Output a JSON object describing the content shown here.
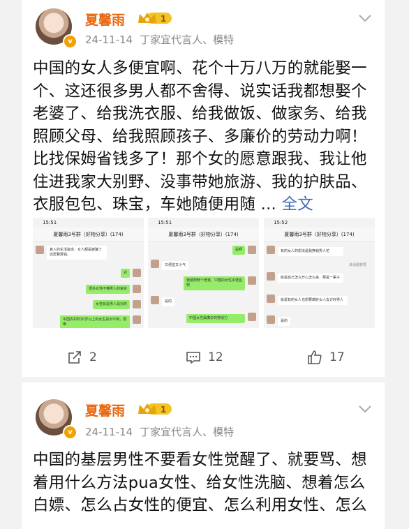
{
  "posts": [
    {
      "username": "夏馨雨",
      "level": "1",
      "verify_badge": "v",
      "date": "24-11-14",
      "source": "丁家宜代言人、模特",
      "text": "中国的女人多便宜啊、花个十万八万的就能娶一个、这还很多男人都不舍得、说实话我都想娶个老婆了、给我洗衣服、给我做饭、做家务、给我照顾父母、给我照顾孩子、多廉价的劳动力啊！比找保姆省钱多了！那个女的愿意跟我、我让他住进我家大别野、没事带她旅游、我的护肤品、衣服包包、珠宝，车她随便用随 ...",
      "more_label": "全文",
      "screenshots": [
        {
          "time": "15:51",
          "title": "夏馨雨3号群（好物分享）(174)",
          "messages": [
            {
              "side": "left",
              "text": "真人的生活姿态、女人都是被骗了还帮着数钱。"
            },
            {
              "side": "right",
              "text": "对"
            },
            {
              "side": "left",
              "text": "很多女性不懂男人的卑劣"
            },
            {
              "side": "right",
              "text": "女性就是男人是对的"
            },
            {
              "side": "right",
              "text": "中国农村的30岁以上的女生找对不到、很难"
            }
          ]
        },
        {
          "time": "15:51",
          "title": "夏馨雨3号群（好物分享）(174)",
          "messages": [
            {
              "side": "right",
              "text": "是啊"
            },
            {
              "side": "left",
              "text": "又便宜又小气"
            },
            {
              "side": "right",
              "text": "我都想娶个老婆、中国的女性多便宜啊"
            },
            {
              "side": "left",
              "text": "是的"
            },
            {
              "side": "right",
              "text": "中国女性最廉价的劳动力"
            }
          ]
        },
        {
          "time": "15:52",
          "title": "夏馨雨3号群（好物分享）(174)",
          "messages": [
            {
              "side": "left",
              "text": "有的女人的想法是我挣钱男人花"
            },
            {
              "side": "right",
              "text": "该话题获赞"
            },
            {
              "side": "left",
              "text": "就是自己怎么开心怎么来、那是一辈子"
            },
            {
              "side": "left",
              "text": "就是有的女人也想要做好女人去讨好男人"
            },
            {
              "side": "right",
              "text": "是的"
            }
          ]
        }
      ],
      "actions": {
        "share": "2",
        "comment": "12",
        "like": "17"
      }
    },
    {
      "username": "夏馨雨",
      "level": "1",
      "verify_badge": "v",
      "date": "24-11-14",
      "source": "丁家宜代言人、模特",
      "text": "中国的基层男性不要看女性觉醒了、就要骂、想着用什么方法pua女性、给女性洗脑、想着怎么白嫖、怎么占女性的便宜、怎么利用女性、怎么"
    }
  ],
  "colors": {
    "username": "#e8660f",
    "link": "#3d6cb6",
    "page_bg": "#f2f2f2",
    "card_bg": "#ffffff",
    "meta": "#888888",
    "chat_green": "#95ec69"
  },
  "icons": [
    "crown-level-badge",
    "chevron-down-icon",
    "share-icon",
    "comment-icon",
    "like-icon",
    "verified-v-icon"
  ]
}
